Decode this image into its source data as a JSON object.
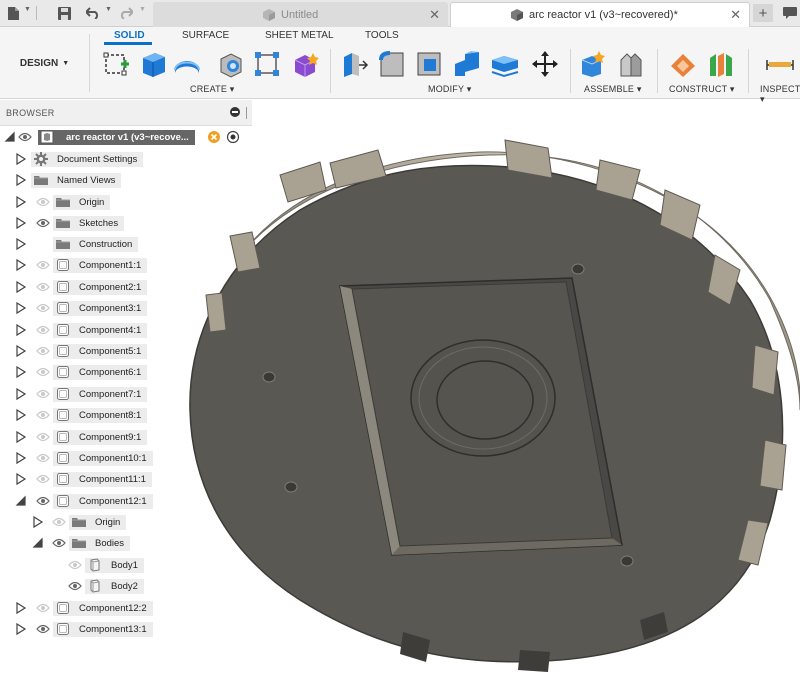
{
  "quick_access": {
    "icons": [
      "file-icon",
      "save-icon",
      "undo-icon",
      "redo-icon"
    ]
  },
  "tabs": [
    {
      "label": "Untitled",
      "active": false
    },
    {
      "label": "arc reactor v1 (v3~recovered)*",
      "active": true
    }
  ],
  "toolbar": {
    "workspace_label": "DESIGN",
    "workspace_tabs": [
      "SOLID",
      "SURFACE",
      "SHEET METAL",
      "TOOLS"
    ],
    "active_workspace_tab": "SOLID",
    "groups": {
      "create": "CREATE",
      "modify": "MODIFY",
      "assemble": "ASSEMBLE",
      "construct": "CONSTRUCT",
      "inspect": "INSPECT"
    }
  },
  "browser": {
    "title": "BROWSER",
    "root": {
      "label": "arc reactor v1 (v3~recove..."
    },
    "items": [
      {
        "label": "Document Settings",
        "icon": "gear-icon"
      },
      {
        "label": "Named Views",
        "icon": "folder-icon"
      },
      {
        "label": "Origin",
        "icon": "folder-icon"
      },
      {
        "label": "Sketches",
        "icon": "folder-icon"
      },
      {
        "label": "Construction",
        "icon": "folder-icon"
      },
      {
        "label": "Component1:1",
        "icon": "component-icon"
      },
      {
        "label": "Component2:1",
        "icon": "component-icon"
      },
      {
        "label": "Component3:1",
        "icon": "component-icon"
      },
      {
        "label": "Component4:1",
        "icon": "component-icon"
      },
      {
        "label": "Component5:1",
        "icon": "component-icon"
      },
      {
        "label": "Component6:1",
        "icon": "component-icon"
      },
      {
        "label": "Component7:1",
        "icon": "component-icon"
      },
      {
        "label": "Component8:1",
        "icon": "component-icon"
      },
      {
        "label": "Component9:1",
        "icon": "component-icon"
      },
      {
        "label": "Component10:1",
        "icon": "component-icon"
      },
      {
        "label": "Component11:1",
        "icon": "component-icon"
      },
      {
        "label": "Component12:1",
        "icon": "component-icon"
      },
      {
        "label": "Origin",
        "icon": "folder-icon"
      },
      {
        "label": "Bodies",
        "icon": "folder-icon"
      },
      {
        "label": "Body1",
        "icon": "body-icon"
      },
      {
        "label": "Body2",
        "icon": "body-icon"
      },
      {
        "label": "Component12:2",
        "icon": "component-icon"
      },
      {
        "label": "Component13:1",
        "icon": "component-icon"
      }
    ]
  },
  "colors": {
    "accent": "#0a70c8",
    "model_face": "#5a5853",
    "model_side": "#a9a293",
    "model_side_light": "#cfc8b8"
  }
}
